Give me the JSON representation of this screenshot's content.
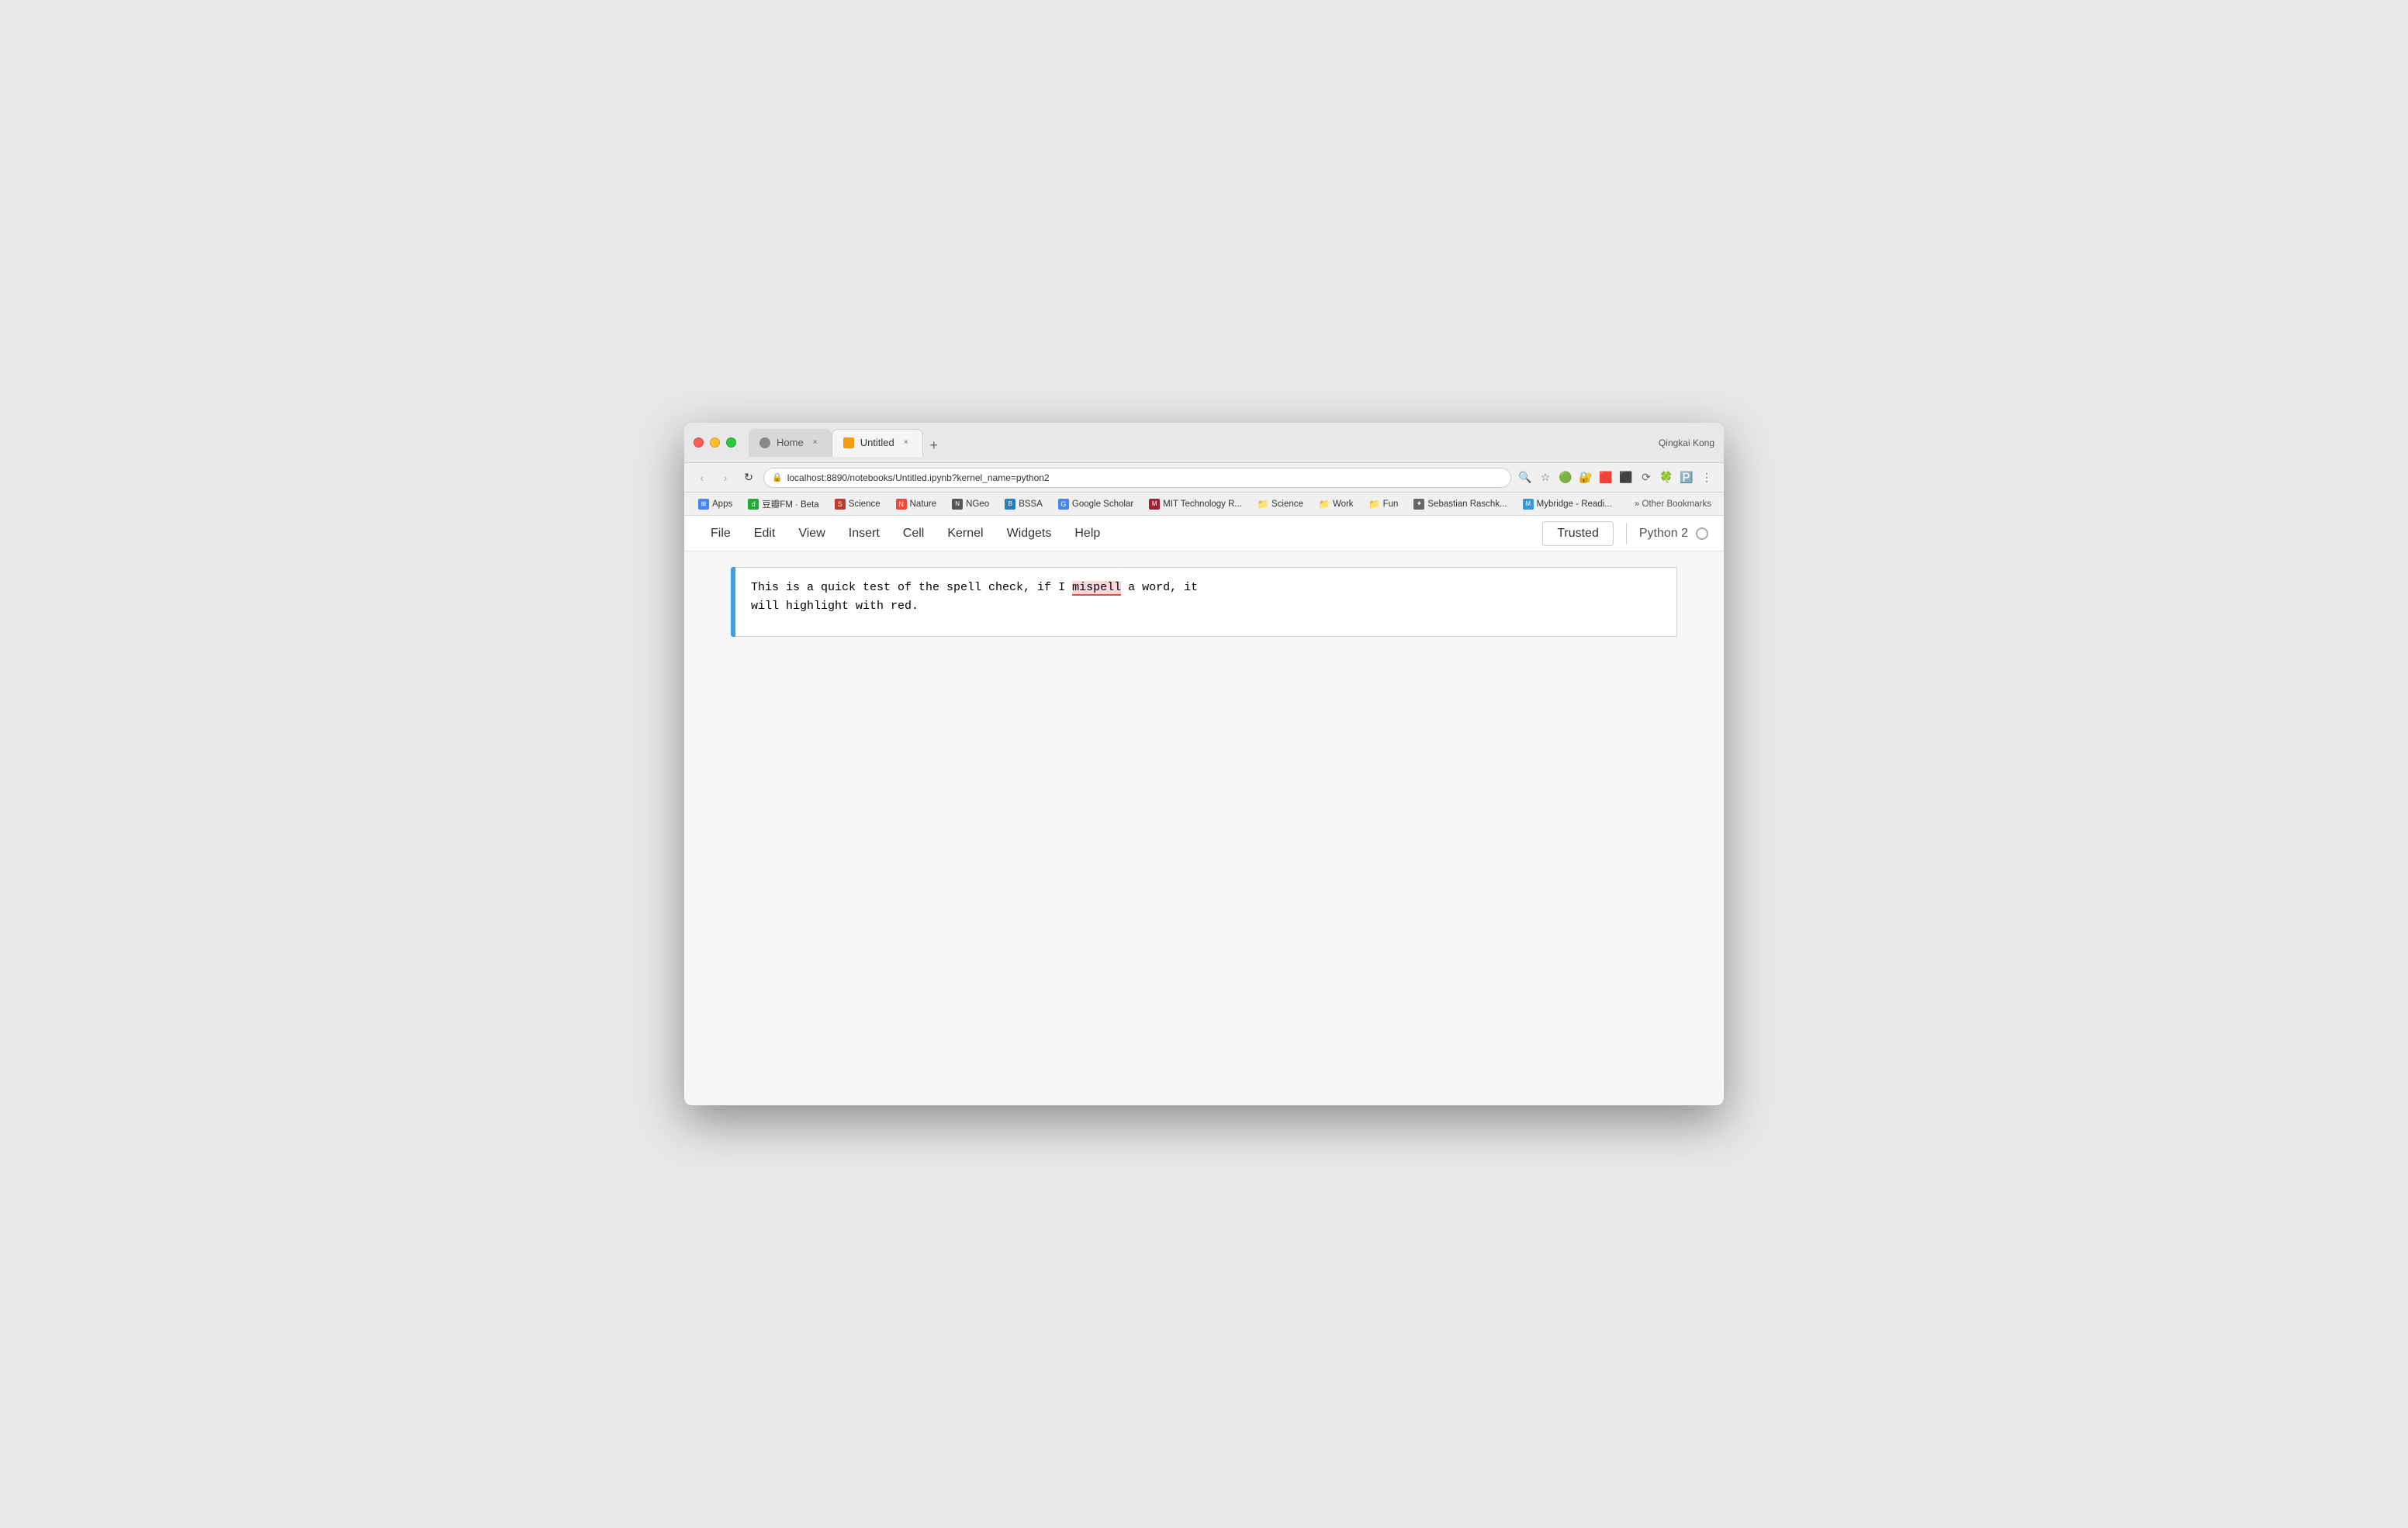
{
  "browser": {
    "user": "Qingkai Kong",
    "tabs": [
      {
        "id": "tab-home",
        "label": "Home",
        "icon_color": "#888",
        "active": false
      },
      {
        "id": "tab-untitled",
        "label": "Untitled",
        "icon_color": "#f39c12",
        "active": true
      }
    ],
    "address": "localhost:8890/notebooks/Untitled.ipynb?kernel_name=python2"
  },
  "bookmarks": [
    {
      "id": "bm-apps",
      "label": "Apps",
      "icon_class": "bm-apps",
      "icon_text": "⊞"
    },
    {
      "id": "bm-douban",
      "label": "豆瓣FM · Beta",
      "icon_class": "bm-douban",
      "icon_text": "d"
    },
    {
      "id": "bm-science",
      "label": "Science",
      "icon_class": "bm-science",
      "icon_text": "S"
    },
    {
      "id": "bm-nature",
      "label": "Nature",
      "icon_class": "bm-nature",
      "icon_text": "N"
    },
    {
      "id": "bm-ngeo",
      "label": "NGeo",
      "icon_class": "bm-ngeo",
      "icon_text": "N"
    },
    {
      "id": "bm-bssa",
      "label": "BSSA",
      "icon_class": "bm-bssa",
      "icon_text": "B"
    },
    {
      "id": "bm-gscholar",
      "label": "Google Scholar",
      "icon_class": "bm-gscholar",
      "icon_text": "G"
    },
    {
      "id": "bm-mit",
      "label": "MIT Technology R...",
      "icon_class": "bm-mit",
      "icon_text": "M"
    },
    {
      "id": "bm-sci2",
      "label": "Science",
      "icon_class": "bm-sci",
      "icon_text": "📁"
    },
    {
      "id": "bm-work",
      "label": "Work",
      "icon_class": "bm-work",
      "icon_text": "📁"
    },
    {
      "id": "bm-fun",
      "label": "Fun",
      "icon_class": "bm-fun",
      "icon_text": "📁"
    },
    {
      "id": "bm-sebastian",
      "label": "Sebastian Raschk...",
      "icon_class": "bm-sebastian",
      "icon_text": "✦"
    },
    {
      "id": "bm-mybridge",
      "label": "Mybridge - Readi...",
      "icon_class": "bm-mybridge",
      "icon_text": "M"
    }
  ],
  "bookmarks_more": "» Other Bookmarks",
  "jupyter": {
    "menu_items": [
      "File",
      "Edit",
      "View",
      "Insert",
      "Cell",
      "Kernel",
      "Widgets",
      "Help"
    ],
    "trusted_label": "Trusted",
    "kernel_label": "Python 2"
  },
  "notebook": {
    "cell_text_part1": "This is a quick test of the spell check, if I ",
    "cell_misspelled": "mispell",
    "cell_text_part2": " a word, it\nwill highlight with red."
  }
}
